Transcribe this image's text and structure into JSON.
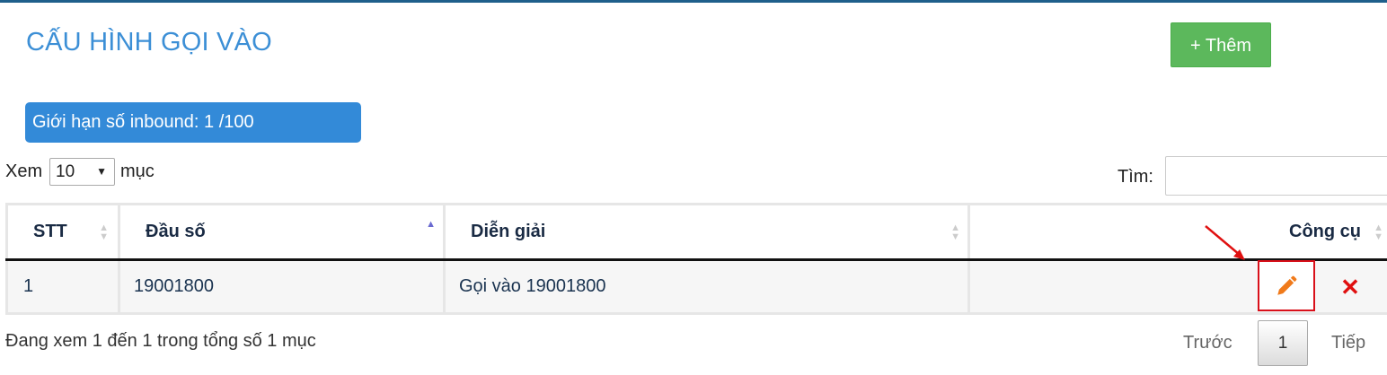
{
  "page": {
    "title": "CẤU HÌNH GỌI VÀO",
    "add_button": "+ Thêm"
  },
  "limit": {
    "text": "Giới hạn số inbound: 1 /100"
  },
  "length_menu": {
    "prefix": "Xem",
    "value": "10",
    "suffix": "mục"
  },
  "search": {
    "label": "Tìm:",
    "value": ""
  },
  "table": {
    "headers": [
      "STT",
      "Đầu số",
      "Diễn giải",
      "Công cụ"
    ],
    "rows": [
      {
        "stt": "1",
        "dau_so": "19001800",
        "dien_giai": "Gọi vào 19001800"
      }
    ]
  },
  "footer": {
    "info": "Đang xem 1 đến 1 trong tổng số 1 mục"
  },
  "pagination": {
    "prev": "Trước",
    "current": "1",
    "next": "Tiếp"
  },
  "colors": {
    "title": "#3c8fd6",
    "add_button": "#5cb85c",
    "limit_box": "#338ad8",
    "highlight": "#d9101a",
    "edit_icon": "#f07a1a",
    "delete_icon": "#e01010"
  },
  "icons": {
    "edit": "pencil-icon",
    "delete": "close-icon",
    "sort": "sort-icon"
  }
}
